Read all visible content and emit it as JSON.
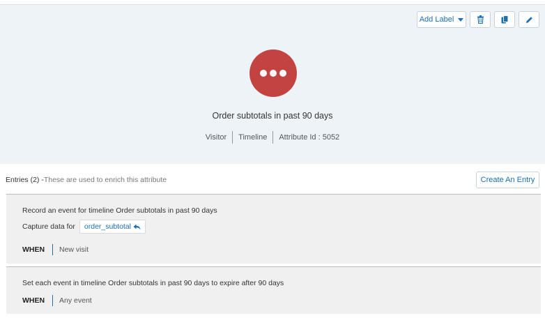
{
  "toolbar": {
    "add_label": "Add Label",
    "icons": [
      "trash-icon",
      "copy-icon",
      "pencil-icon"
    ]
  },
  "attribute": {
    "title": "Order subtotals in past 90 days",
    "meta": [
      "Visitor",
      "Timeline",
      "Attribute Id : 5052"
    ],
    "avatar_color": "#c24340"
  },
  "entries": {
    "label": "Entries (2) -",
    "hint": "These are used to enrich this attribute",
    "create_label": "Create An Entry",
    "items": [
      {
        "description": "Record an event for timeline Order subtotals in past 90 days",
        "capture_label": "Capture data for",
        "capture_chip": "order_subtotal",
        "when_label": "WHEN",
        "when_value": "New visit"
      },
      {
        "description": "Set each event in timeline Order subtotals in past 90 days to expire after 90 days",
        "when_label": "WHEN",
        "when_value": "Any event"
      }
    ]
  },
  "colors": {
    "accent": "#1a6fb5",
    "panel": "#eef3f8",
    "card": "#f0f0f0"
  }
}
